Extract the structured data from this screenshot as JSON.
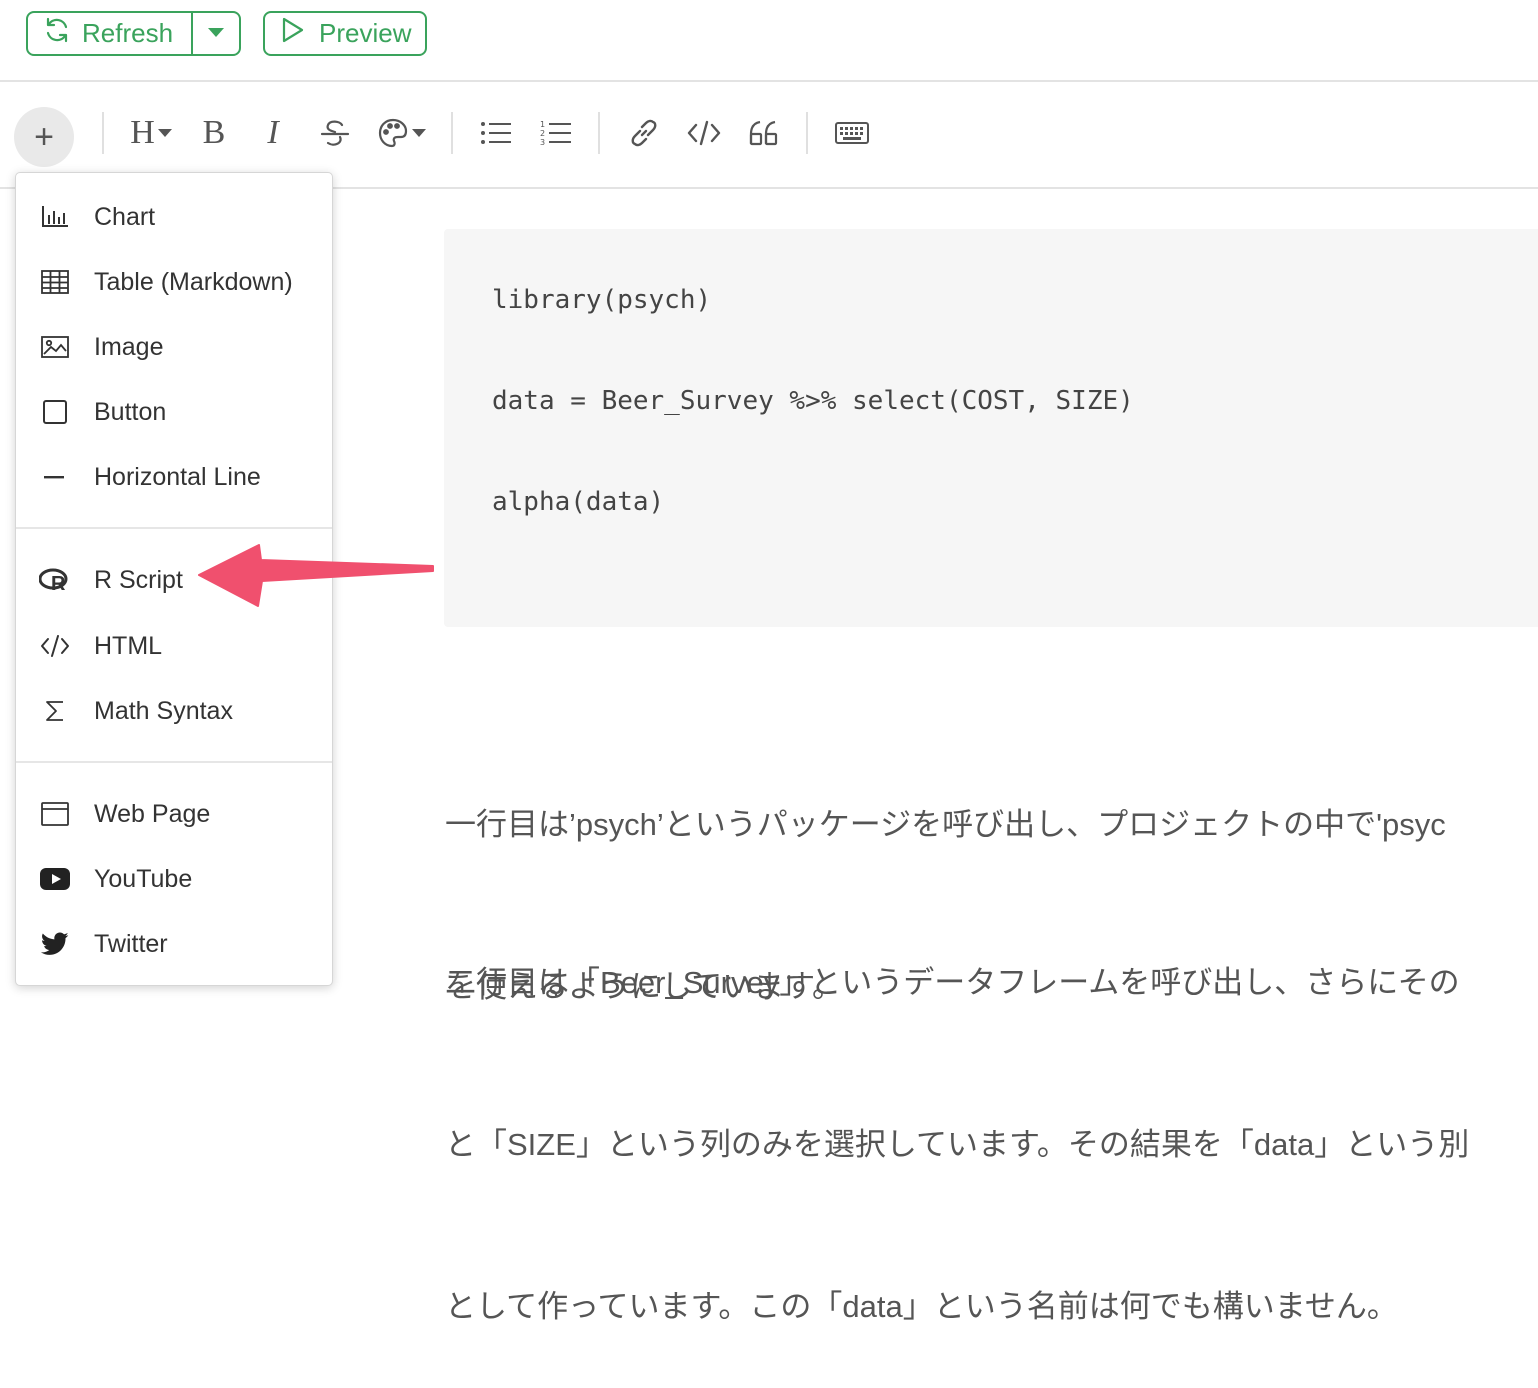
{
  "header": {
    "refresh_label": "Refresh",
    "preview_label": "Preview",
    "accent_color": "#3aa35c"
  },
  "toolbar": {
    "plus_label": "+",
    "heading_label": "H",
    "bold_label": "B",
    "italic_label": "I",
    "icons": [
      "heading-icon",
      "bold-icon",
      "italic-icon",
      "strikethrough-icon",
      "color-palette-icon",
      "bullet-list-icon",
      "numbered-list-icon",
      "link-icon",
      "code-icon",
      "quote-icon",
      "keyboard-icon"
    ]
  },
  "menu": {
    "items": [
      {
        "label": "Chart",
        "icon": "bar-chart-icon"
      },
      {
        "label": "Table (Markdown)",
        "icon": "table-icon"
      },
      {
        "label": "Image",
        "icon": "image-icon"
      },
      {
        "label": "Button",
        "icon": "square-icon"
      },
      {
        "label": "Horizontal Line",
        "icon": "minus-icon"
      },
      {
        "label": "R Script",
        "icon": "r-logo-icon"
      },
      {
        "label": "HTML",
        "icon": "code-icon"
      },
      {
        "label": "Math Syntax",
        "icon": "sigma-icon"
      },
      {
        "label": "Web Page",
        "icon": "browser-window-icon"
      },
      {
        "label": "YouTube",
        "icon": "youtube-icon"
      },
      {
        "label": "Twitter",
        "icon": "twitter-icon"
      }
    ],
    "highlighted": "R Script",
    "arrow_color": "#f0506e"
  },
  "code_block": {
    "lines": [
      "library(psych)",
      "data = Beer_Survey %>% select(COST, SIZE)",
      "alpha(data)"
    ]
  },
  "paragraphs": [
    [
      "一行目は’psych’というパッケージを呼び出し、プロジェクトの中で'psyc",
      "を使えるようにしています。"
    ],
    [
      "二行目は「Beer_Survey」というデータフレームを呼び出し、さらにその",
      "と「SIZE」という列のみを選択しています。その結果を「data」という別",
      "として作っています。この「data」という名前は何でも構いません。"
    ]
  ]
}
